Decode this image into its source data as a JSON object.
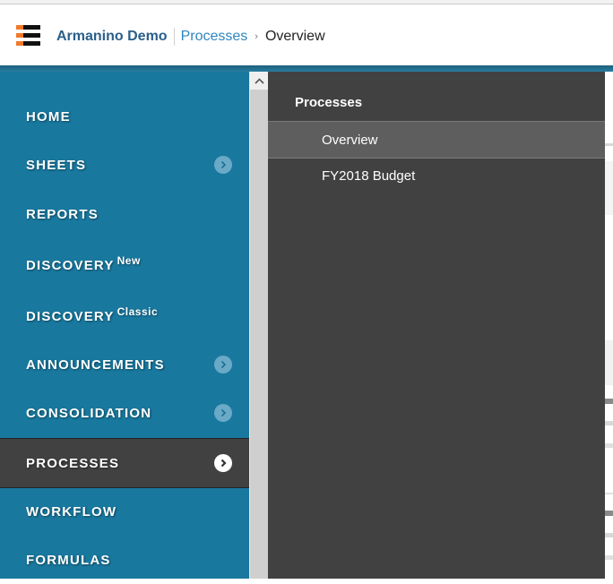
{
  "header": {
    "app_name": "Armanino Demo",
    "breadcrumb": [
      {
        "label": "Processes"
      },
      {
        "label": "Overview"
      }
    ],
    "breadcrumb_separator": "›",
    "menu_icon": "hamburger-menu-icon"
  },
  "colors": {
    "sidebar_bg": "#19789e",
    "active_item_bg": "#414142",
    "panel_bg": "#414142",
    "accent_orange": "#f07a2a",
    "brand_blue": "#2b5f8a"
  },
  "sidebar": {
    "items": [
      {
        "label": "HOME",
        "sup": "",
        "has_chevron": false,
        "active": false
      },
      {
        "label": "SHEETS",
        "sup": "",
        "has_chevron": true,
        "active": false
      },
      {
        "label": "REPORTS",
        "sup": "",
        "has_chevron": false,
        "active": false
      },
      {
        "label": "DISCOVERY",
        "sup": "New",
        "has_chevron": false,
        "active": false
      },
      {
        "label": "DISCOVERY",
        "sup": "Classic",
        "has_chevron": false,
        "active": false
      },
      {
        "label": "ANNOUNCEMENTS",
        "sup": "",
        "has_chevron": true,
        "active": false
      },
      {
        "label": "CONSOLIDATION",
        "sup": "",
        "has_chevron": true,
        "active": false
      },
      {
        "label": "PROCESSES",
        "sup": "",
        "has_chevron": true,
        "active": true
      },
      {
        "label": "WORKFLOW",
        "sup": "",
        "has_chevron": false,
        "active": false
      },
      {
        "label": "FORMULAS",
        "sup": "",
        "has_chevron": false,
        "active": false
      }
    ]
  },
  "flyout": {
    "title": "Processes",
    "items": [
      {
        "label": "Overview",
        "active": true
      },
      {
        "label": "FY2018 Budget",
        "active": false
      }
    ]
  }
}
